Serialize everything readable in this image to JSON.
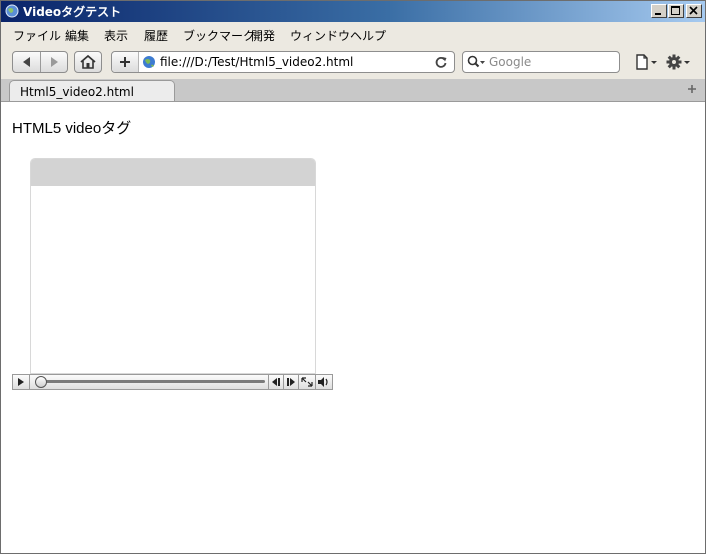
{
  "window": {
    "title": "Videoタグテスト",
    "icons": [
      "globe-icon",
      "minimize-icon",
      "maximize-icon",
      "close-icon"
    ]
  },
  "menu": {
    "items": [
      "ファイル",
      "編集",
      "表示",
      "履歴",
      "ブックマーク",
      "開発",
      "ウィンドウ",
      "ヘルプ"
    ]
  },
  "toolbar": {
    "url": "file:///D:/Test/Html5_video2.html",
    "search_placeholder": "Google",
    "icons": [
      "back-icon",
      "forward-icon",
      "home-icon",
      "add-bookmark-icon",
      "reload-icon",
      "page-menu-icon",
      "settings-icon"
    ]
  },
  "tabs": [
    {
      "label": "Html5_video2.html",
      "active": true
    }
  ],
  "page": {
    "heading": "HTML5 videoタグ"
  },
  "video": {
    "progress": 0,
    "controls": [
      "play-icon",
      "seek-slider",
      "step-back-icon",
      "step-forward-icon",
      "fullscreen-icon",
      "volume-icon"
    ]
  },
  "colors": {
    "titlebar_start": "#0a246a",
    "titlebar_end": "#a6caf0",
    "chrome": "#ece9e1",
    "tabstrip": "#c8c8c8"
  }
}
